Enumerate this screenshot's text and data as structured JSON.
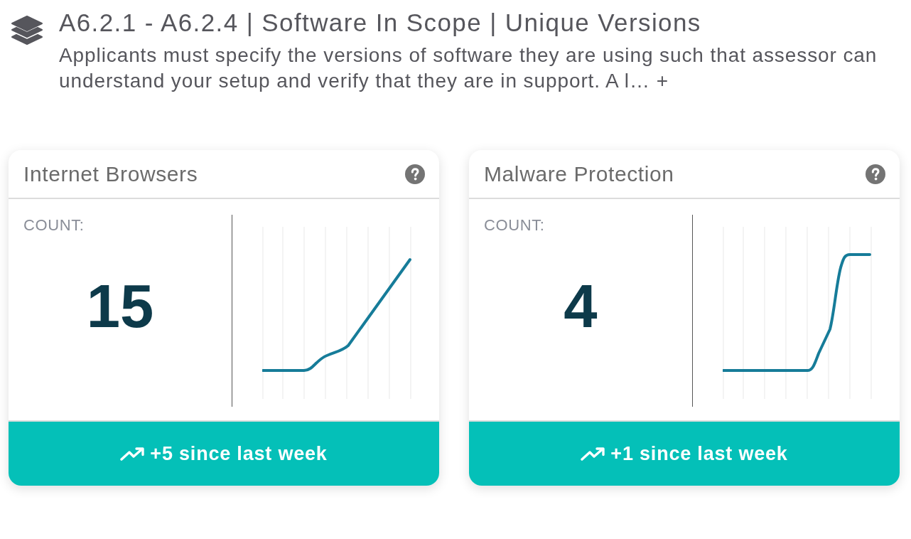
{
  "header": {
    "title": "A6.2.1 - A6.2.4 | Software In Scope | Unique Versions",
    "description_lines": [
      "Applicants must specify the versions of software they are using such that assessor can",
      "understand your setup and verify that they are in support. A l…"
    ],
    "expand": "+"
  },
  "cards": [
    {
      "title": "Internet Browsers",
      "count_label": "COUNT:",
      "count": "15",
      "trend": "+5 since last week"
    },
    {
      "title": "Malware Protection",
      "count_label": "COUNT:",
      "count": "4",
      "trend": "+1 since last week"
    }
  ]
}
